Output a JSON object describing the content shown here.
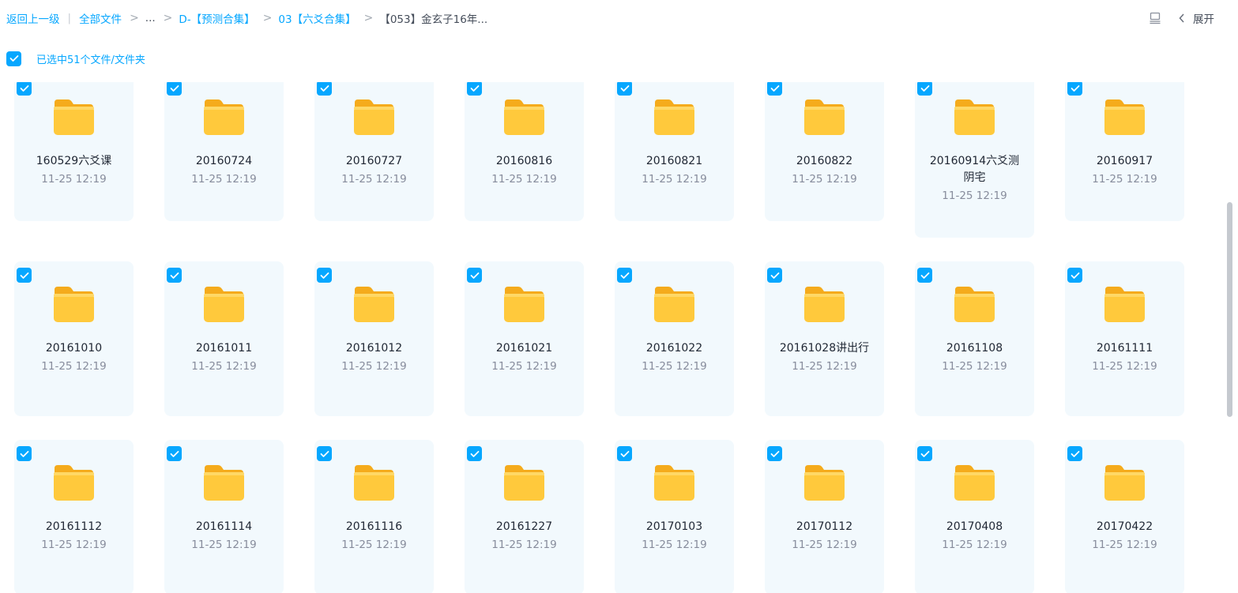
{
  "breadcrumb": {
    "back": "返回上一级",
    "all_files": "全部文件",
    "ellipsis": "...",
    "sep": ">",
    "level1": "D-【预测合集】",
    "level2": "03【六爻合集】",
    "current": "【053】金玄子16年..."
  },
  "toolbar": {
    "expand_label": "展开"
  },
  "selection": {
    "label": "已选中51个文件/文件夹"
  },
  "colors": {
    "accent": "#06a7ff",
    "card_bg": "#f2f9fd",
    "folder": "#ffc93c"
  },
  "files": [
    {
      "name": "160529六爻课",
      "date": "11-25 12:19"
    },
    {
      "name": "20160724",
      "date": "11-25 12:19"
    },
    {
      "name": "20160727",
      "date": "11-25 12:19"
    },
    {
      "name": "20160816",
      "date": "11-25 12:19"
    },
    {
      "name": "20160821",
      "date": "11-25 12:19"
    },
    {
      "name": "20160822",
      "date": "11-25 12:19"
    },
    {
      "name": "20160914六爻测阴宅",
      "date": "11-25 12:19"
    },
    {
      "name": "20160917",
      "date": "11-25 12:19"
    },
    {
      "name": "20161010",
      "date": "11-25 12:19"
    },
    {
      "name": "20161011",
      "date": "11-25 12:19"
    },
    {
      "name": "20161012",
      "date": "11-25 12:19"
    },
    {
      "name": "20161021",
      "date": "11-25 12:19"
    },
    {
      "name": "20161022",
      "date": "11-25 12:19"
    },
    {
      "name": "20161028讲出行",
      "date": "11-25 12:19"
    },
    {
      "name": "20161108",
      "date": "11-25 12:19"
    },
    {
      "name": "20161111",
      "date": "11-25 12:19"
    },
    {
      "name": "20161112",
      "date": "11-25 12:19"
    },
    {
      "name": "20161114",
      "date": "11-25 12:19"
    },
    {
      "name": "20161116",
      "date": "11-25 12:19"
    },
    {
      "name": "20161227",
      "date": "11-25 12:19"
    },
    {
      "name": "20170103",
      "date": "11-25 12:19"
    },
    {
      "name": "20170112",
      "date": "11-25 12:19"
    },
    {
      "name": "20170408",
      "date": "11-25 12:19"
    },
    {
      "name": "20170422",
      "date": "11-25 12:19"
    }
  ]
}
